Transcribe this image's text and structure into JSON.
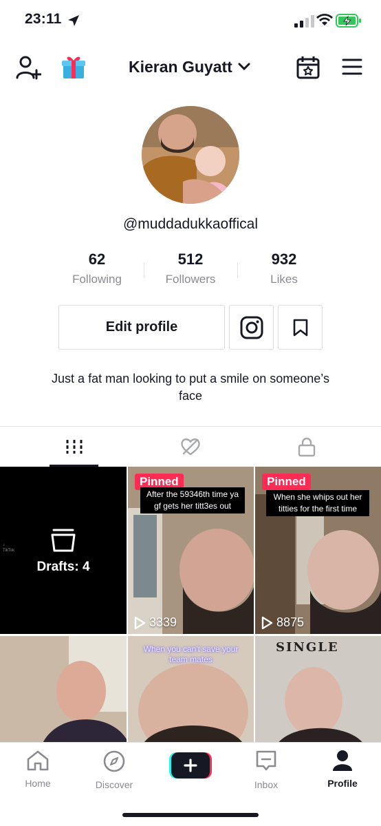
{
  "status_bar": {
    "time": "23:11"
  },
  "header": {
    "name": "Kieran Guyatt"
  },
  "profile": {
    "username": "@muddadukkaoffical",
    "stats": [
      {
        "count": "62",
        "label": "Following"
      },
      {
        "count": "512",
        "label": "Followers"
      },
      {
        "count": "932",
        "label": "Likes"
      }
    ],
    "edit_label": "Edit profile",
    "bio": "Just a fat man looking to put a smile on someone’s face"
  },
  "grid": {
    "drafts_label": "Drafts: 4",
    "items": [
      {
        "pinned": "Pinned",
        "caption": "After the 59346th time ya gf gets her titt3es out",
        "views": "3339"
      },
      {
        "pinned": "Pinned",
        "caption": "When she whips out her titties for the first time",
        "views": "8875"
      },
      {
        "caption": ""
      },
      {
        "caption": "When you can't save your team mates"
      },
      {
        "sticker": "SINGLE"
      }
    ]
  },
  "nav": {
    "home": "Home",
    "discover": "Discover",
    "inbox": "Inbox",
    "profile": "Profile"
  },
  "colors": {
    "accent": "#fe2c55",
    "cyan": "#25f4ee",
    "text": "#161823",
    "muted": "#8a8b91"
  }
}
